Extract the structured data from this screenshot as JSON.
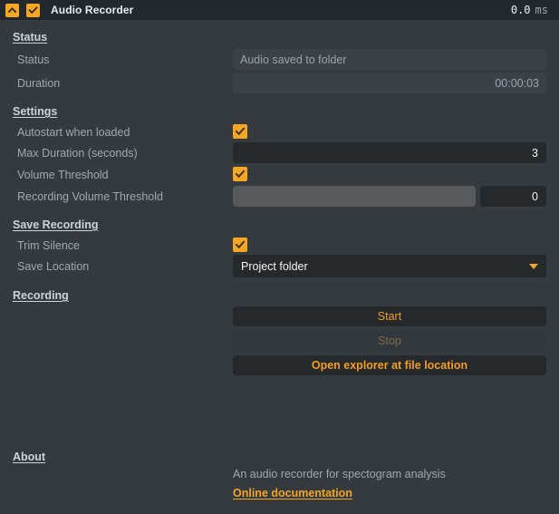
{
  "titlebar": {
    "collapse_icon": "chevron-up-icon",
    "enabled_icon": "checkbox-checked-icon",
    "title": "Audio Recorder",
    "timing_value": "0.0",
    "timing_unit": "ms"
  },
  "sections": {
    "status": {
      "heading": "Status",
      "rows": {
        "status": {
          "label": "Status",
          "value": "Audio saved to folder"
        },
        "duration": {
          "label": "Duration",
          "value": "00:00:03"
        }
      }
    },
    "settings": {
      "heading": "Settings",
      "rows": {
        "autostart": {
          "label": "Autostart when loaded",
          "checked": "✓"
        },
        "max_duration": {
          "label": "Max Duration (seconds)",
          "value": "3"
        },
        "volume_threshold": {
          "label": "Volume Threshold",
          "checked": "✓"
        },
        "recording_volume_threshold": {
          "label": "Recording Volume Threshold",
          "value": "0",
          "slider_fill_percent": 0
        }
      }
    },
    "save_recording": {
      "heading": "Save Recording",
      "rows": {
        "trim_silence": {
          "label": "Trim Silence",
          "checked": "✓"
        },
        "save_location": {
          "label": "Save Location",
          "value": "Project folder",
          "options": [
            "Project folder"
          ]
        }
      }
    },
    "recording": {
      "heading": "Recording",
      "buttons": {
        "start": "Start",
        "stop": "Stop",
        "open_explorer": "Open explorer at file location"
      }
    },
    "about": {
      "heading": "About",
      "description": "An audio recorder for spectogram analysis",
      "link": "Online documentation"
    }
  },
  "colors": {
    "accent": "#f5a623",
    "titlebar_bg": "#23282c",
    "body_bg": "#343a3e",
    "field_bg": "#25292c",
    "readonly_bg": "#3b4146",
    "slider_track": "#58595b"
  }
}
